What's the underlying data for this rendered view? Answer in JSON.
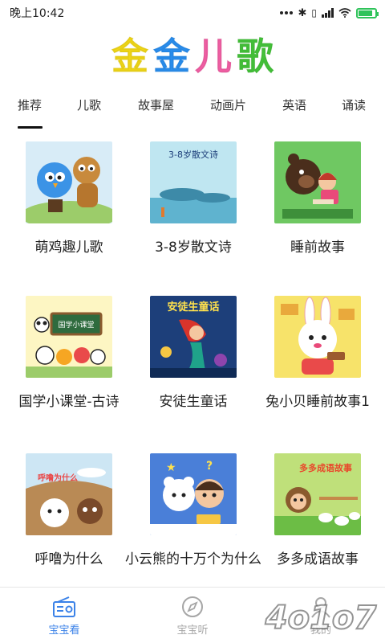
{
  "status_bar": {
    "time": "晚上10:42",
    "battery_level": 0.85
  },
  "app": {
    "logo_chars": [
      {
        "char": "金",
        "color": "#f2d817"
      },
      {
        "char": "金",
        "color": "#2a8ff0"
      },
      {
        "char": "儿",
        "color": "#f35fa5"
      },
      {
        "char": "歌",
        "color": "#45c43a"
      }
    ]
  },
  "tabs": [
    {
      "label": "推荐",
      "active": true
    },
    {
      "label": "儿歌",
      "active": false
    },
    {
      "label": "故事屋",
      "active": false
    },
    {
      "label": "动画片",
      "active": false
    },
    {
      "label": "英语",
      "active": false
    },
    {
      "label": "诵读",
      "active": false
    }
  ],
  "cards": [
    {
      "label": "萌鸡趣儿歌",
      "bg": "#d8ecf7",
      "thumb_text": ""
    },
    {
      "label": "3-8岁散文诗",
      "bg": "#bfe6f1",
      "thumb_text": "3-8岁散文诗"
    },
    {
      "label": "睡前故事",
      "bg": "#6fc862",
      "thumb_text": ""
    },
    {
      "label": "国学小课堂-古诗",
      "bg": "#fdf6c3",
      "thumb_text": "国学小课堂"
    },
    {
      "label": "安徒生童话",
      "bg": "#1d3f7a",
      "thumb_text": "安徒生童话"
    },
    {
      "label": "兔小贝睡前故事1",
      "bg": "#f7e36a",
      "thumb_text": ""
    },
    {
      "label": "呼噜为什么",
      "bg": "#b98a55",
      "thumb_text": "呼噜为什么"
    },
    {
      "label": "小云熊的十万个为什么",
      "bg": "#4a7fd8",
      "thumb_text": ""
    },
    {
      "label": "多多成语故事",
      "bg": "#bfe07a",
      "thumb_text": "多多成语故事"
    }
  ],
  "bottom_nav": [
    {
      "label": "宝宝看",
      "icon": "radio-icon",
      "active": true
    },
    {
      "label": "宝宝听",
      "icon": "compass-icon",
      "active": false
    },
    {
      "label": "我的",
      "icon": "person-icon",
      "active": false
    }
  ],
  "watermark": {
    "text": "4o1o7"
  }
}
